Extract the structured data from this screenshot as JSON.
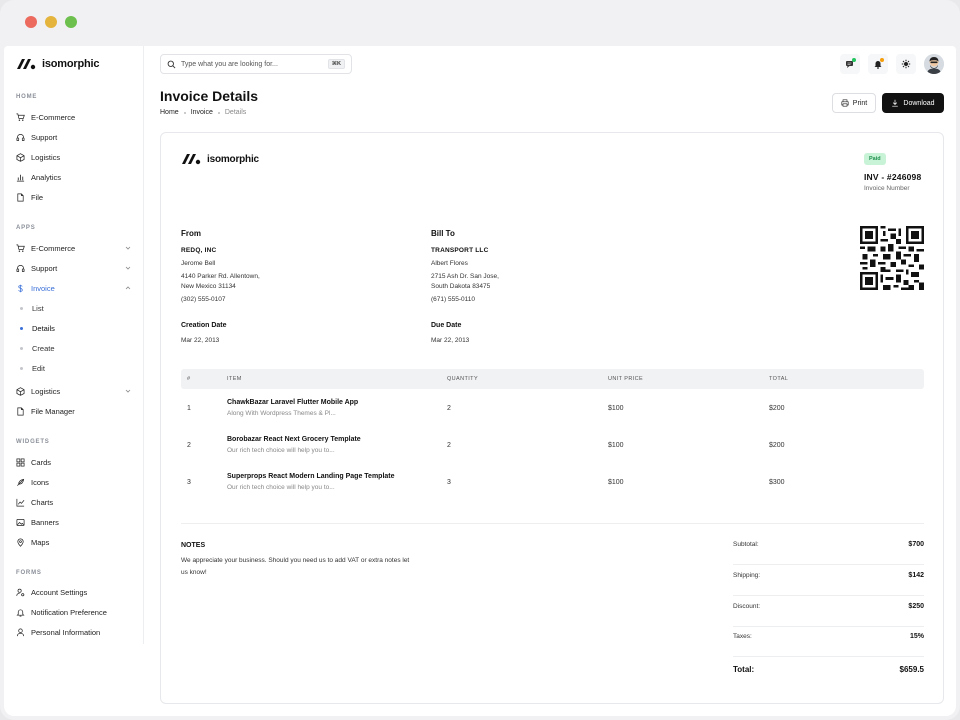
{
  "brand": {
    "name": "isomorphic"
  },
  "sidebar": {
    "sections": {
      "home": "HOME",
      "apps": "APPS",
      "widgets": "WIDGETS",
      "forms": "FORMS"
    },
    "home_items": [
      "E-Commerce",
      "Support",
      "Logistics",
      "Analytics",
      "File"
    ],
    "apps_items": {
      "ecommerce": "E-Commerce",
      "support": "Support",
      "invoice": "Invoice",
      "invoice_sub": [
        "List",
        "Details",
        "Create",
        "Edit"
      ],
      "logistics": "Logistics",
      "file_manager": "File Manager"
    },
    "widget_items": [
      "Cards",
      "Icons",
      "Charts",
      "Banners",
      "Maps"
    ],
    "form_items": [
      "Account Settings",
      "Notification Preference",
      "Personal Information"
    ]
  },
  "header": {
    "search_placeholder": "Type what you are looking for...",
    "search_shortcut": "⌘K"
  },
  "page": {
    "title": "Invoice Details",
    "breadcrumb": [
      "Home",
      "Invoice",
      "Details"
    ],
    "print_label": "Print",
    "download_label": "Download"
  },
  "invoice": {
    "status": "Paid",
    "number": "INV - #246098",
    "number_label": "Invoice Number",
    "from": {
      "heading": "From",
      "company": "REDQ, INC",
      "contact": "Jerome Bell",
      "address1": "4140 Parker Rd. Allentown,",
      "address2": "New Mexico 31134",
      "phone": "(302) 555-0107"
    },
    "bill_to": {
      "heading": "Bill To",
      "company": "TRANSPORT LLC",
      "contact": "Albert Flores",
      "address1": "2715 Ash Dr. San Jose,",
      "address2": "South Dakota 83475",
      "phone": "(671) 555-0110"
    },
    "creation_date_label": "Creation Date",
    "creation_date": "Mar 22, 2013",
    "due_date_label": "Due Date",
    "due_date": "Mar 22, 2013",
    "columns": [
      "#",
      "ITEM",
      "QUANTITY",
      "UNIT PRICE",
      "TOTAL"
    ],
    "items": [
      {
        "no": "1",
        "title": "ChawkBazar Laravel Flutter Mobile App",
        "desc": "Along With Wordpress Themes & Pl...",
        "qty": "2",
        "unit": "$100",
        "total": "$200"
      },
      {
        "no": "2",
        "title": "Borobazar React Next Grocery Template",
        "desc": "Our rich tech choice will help you to...",
        "qty": "2",
        "unit": "$100",
        "total": "$200"
      },
      {
        "no": "3",
        "title": "Superprops React Modern Landing Page Template",
        "desc": "Our rich tech choice will help you to...",
        "qty": "3",
        "unit": "$100",
        "total": "$300"
      }
    ],
    "notes_heading": "NOTES",
    "notes": "We appreciate your business. Should you need us to add VAT or extra notes let us know!",
    "summary": {
      "subtotal_label": "Subtotal:",
      "subtotal": "$700",
      "shipping_label": "Shipping:",
      "shipping": "$142",
      "discount_label": "Discount:",
      "discount": "$250",
      "taxes_label": "Taxes:",
      "taxes": "15%",
      "total_label": "Total:",
      "total": "$659.5"
    }
  },
  "colors": {
    "accent": "#3a6fd8",
    "paid_bg": "#c9f3d7",
    "paid_text": "#1e8f4c",
    "primary_button": "#111111"
  },
  "icons": {
    "window_controls": [
      "close-dot",
      "minimize-dot",
      "maximize-dot"
    ],
    "header": [
      "search-icon",
      "chat-icon",
      "bell-icon",
      "settings-icon",
      "avatar"
    ]
  }
}
